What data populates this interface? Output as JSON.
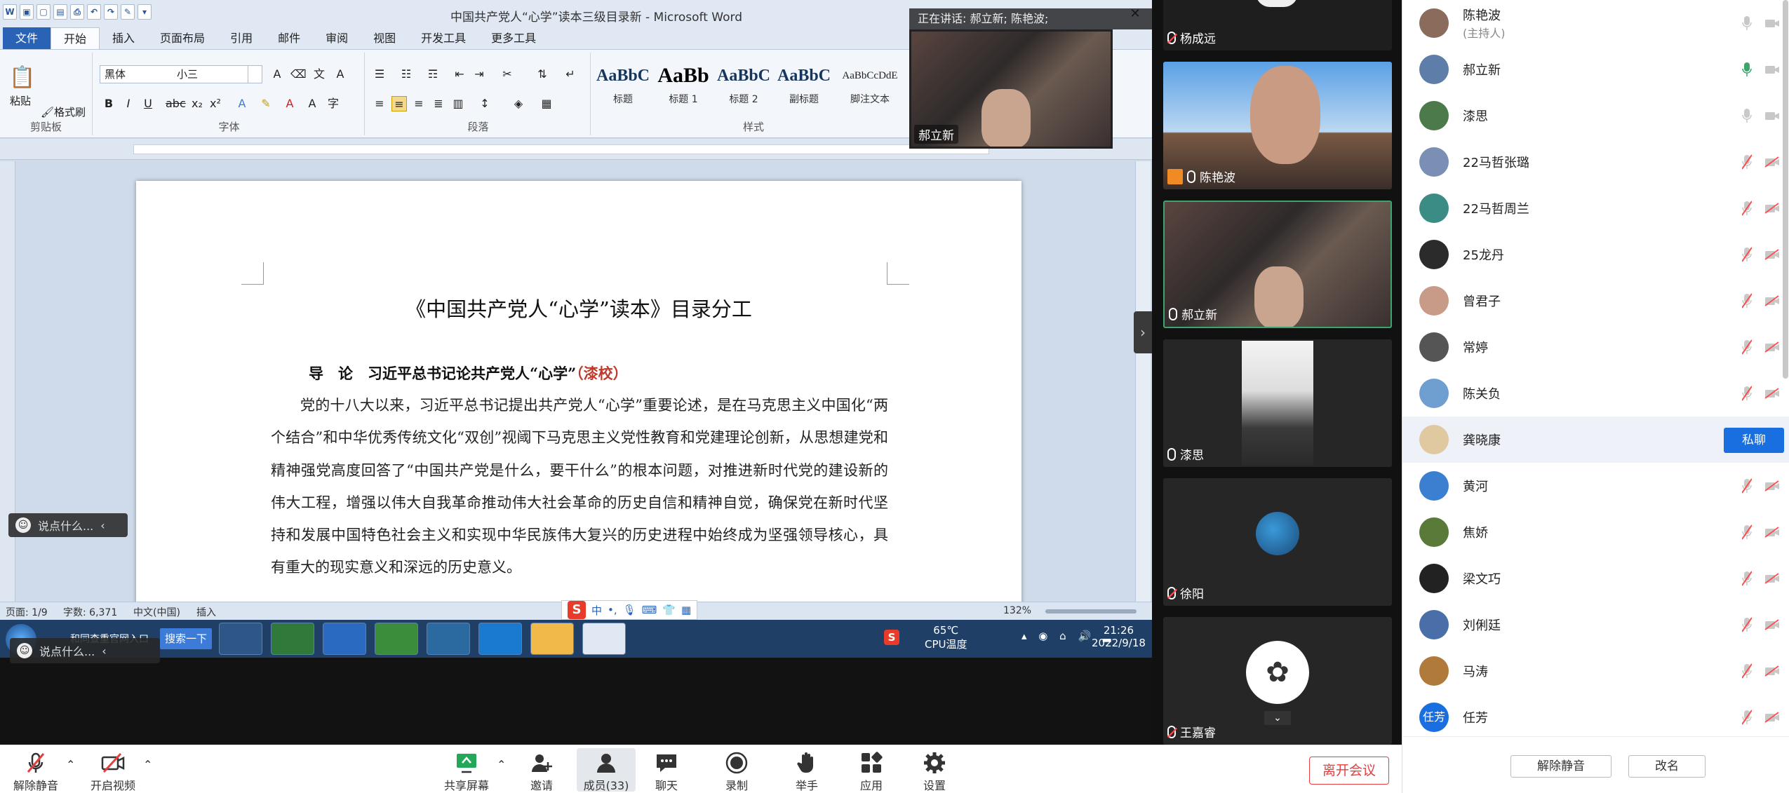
{
  "word": {
    "title": "中国共产党人“心学”读本三级目录新 - Microsoft Word",
    "tabs": [
      "文件",
      "开始",
      "插入",
      "页面布局",
      "引用",
      "邮件",
      "审阅",
      "视图",
      "开发工具",
      "更多工具"
    ],
    "active_tab": "开始",
    "clipboard": {
      "paste": "粘贴",
      "format_painter": "格式刷",
      "label": "剪贴板"
    },
    "font": {
      "name": "黑体",
      "size": "小三",
      "label": "字体"
    },
    "paragraph_label": "段落",
    "styles": {
      "label": "样式",
      "items": [
        {
          "preview": "AaBbC",
          "name": "标题"
        },
        {
          "preview": "AaBb",
          "name": "标题 1"
        },
        {
          "preview": "AaBbC",
          "name": "标题 2"
        },
        {
          "preview": "AaBbC",
          "name": "副标题"
        },
        {
          "preview": "AaBbCcDdE",
          "name": "脚注文本"
        }
      ]
    },
    "document": {
      "heading": "《中国共产党人“心学”读本》目录分工",
      "section_title": "导　论　习近平总书记论共产党人“心学”",
      "section_author": "（漆校）",
      "body": "党的十八大以来，习近平总书记提出共产党人“心学”重要论述，是在马克思主义中国化“两个结合”和中华优秀传统文化“双创”视阈下马克思主义党性教育和党建理论创新，从思想建党和精神强党高度回答了“中国共产党是什么，要干什么”的根本问题，对推进新时代党的建设新的伟大工程，增强以伟大自我革命推动伟大社会革命的历史自信和精神自觉，确保党在新时代坚持和发展中国特色社会主义和实现中华民族伟大复兴的历史进程中始终成为坚强领导核心，具有重大的现实意义和深远的历史意义。"
    },
    "status": {
      "page": "页面: 1/9",
      "words": "字数: 6,371",
      "lang": "中文(中国)",
      "mode": "插入",
      "zoom": "132%"
    }
  },
  "taskbar": {
    "search_label": "搜索一下",
    "notif": "和同查重官网入口",
    "temp": "65℃",
    "temp_label": "CPU温度",
    "time": "21:26",
    "date": "2022/9/18"
  },
  "chat_placeholder": "说点什么...",
  "meeting": {
    "speaking_now": "正在讲话: 郝立新; 陈艳波;",
    "pip_name": "郝立新",
    "tiles": [
      {
        "name": "杨成远",
        "mic": "off"
      },
      {
        "name": "陈艳波",
        "mic": "on",
        "host": true
      },
      {
        "name": "郝立新",
        "mic": "on",
        "active": true
      },
      {
        "name": "漆思",
        "mic": "on"
      },
      {
        "name": "徐阳",
        "mic": "off"
      },
      {
        "name": "王嘉睿",
        "mic": "off"
      }
    ],
    "participants": [
      {
        "name": "陈艳波",
        "sub": "(主持人)",
        "avatar": "#8a6b5c",
        "mic": "on"
      },
      {
        "name": "郝立新",
        "avatar": "#5e7da8",
        "mic": "active"
      },
      {
        "name": "漆思",
        "avatar": "#4d7a4a",
        "mic": "on"
      },
      {
        "name": "22马哲张璐",
        "avatar": "#7a8fb3",
        "mic": "off"
      },
      {
        "name": "22马哲周兰",
        "avatar": "#3a8c84",
        "mic": "off"
      },
      {
        "name": "25龙丹",
        "avatar": "#2b2b2b",
        "mic": "off"
      },
      {
        "name": "曾君子",
        "avatar": "#c89a88",
        "mic": "off"
      },
      {
        "name": "常婷",
        "avatar": "#555555",
        "mic": "off"
      },
      {
        "name": "陈关负",
        "avatar": "#6f9fd0",
        "mic": "off"
      },
      {
        "name": "龚晓康",
        "avatar": "#e0c9a0",
        "mic": "off",
        "highlight": true,
        "action": "私聊"
      },
      {
        "name": "黄河",
        "avatar": "#3a7fd0",
        "mic": "off"
      },
      {
        "name": "焦娇",
        "avatar": "#5a7a3a",
        "mic": "off"
      },
      {
        "name": "梁文巧",
        "avatar": "#222222",
        "mic": "off"
      },
      {
        "name": "刘俐廷",
        "avatar": "#4a6fa8",
        "mic": "off"
      },
      {
        "name": "马涛",
        "avatar": "#b07a3a",
        "mic": "off"
      },
      {
        "name": "任芳",
        "avatar": "#1a6fe0",
        "initials": "任芳",
        "mic": "off"
      }
    ],
    "footer": {
      "unmute_all": "解除静音",
      "rename": "改名"
    }
  },
  "toolbar": {
    "unmute": "解除静音",
    "start_video": "开启视频",
    "share": "共享屏幕",
    "invite": "邀请",
    "members": "成员(33)",
    "chat": "聊天",
    "record": "录制",
    "raise_hand": "举手",
    "apps": "应用",
    "settings": "设置",
    "leave": "离开会议"
  },
  "colors": {
    "accent": "#1a6fe0",
    "leave": "#e53e3e",
    "word_blue": "#2a62b6",
    "muted_red": "#ff4d4f",
    "active_green": "#3ca56e"
  }
}
